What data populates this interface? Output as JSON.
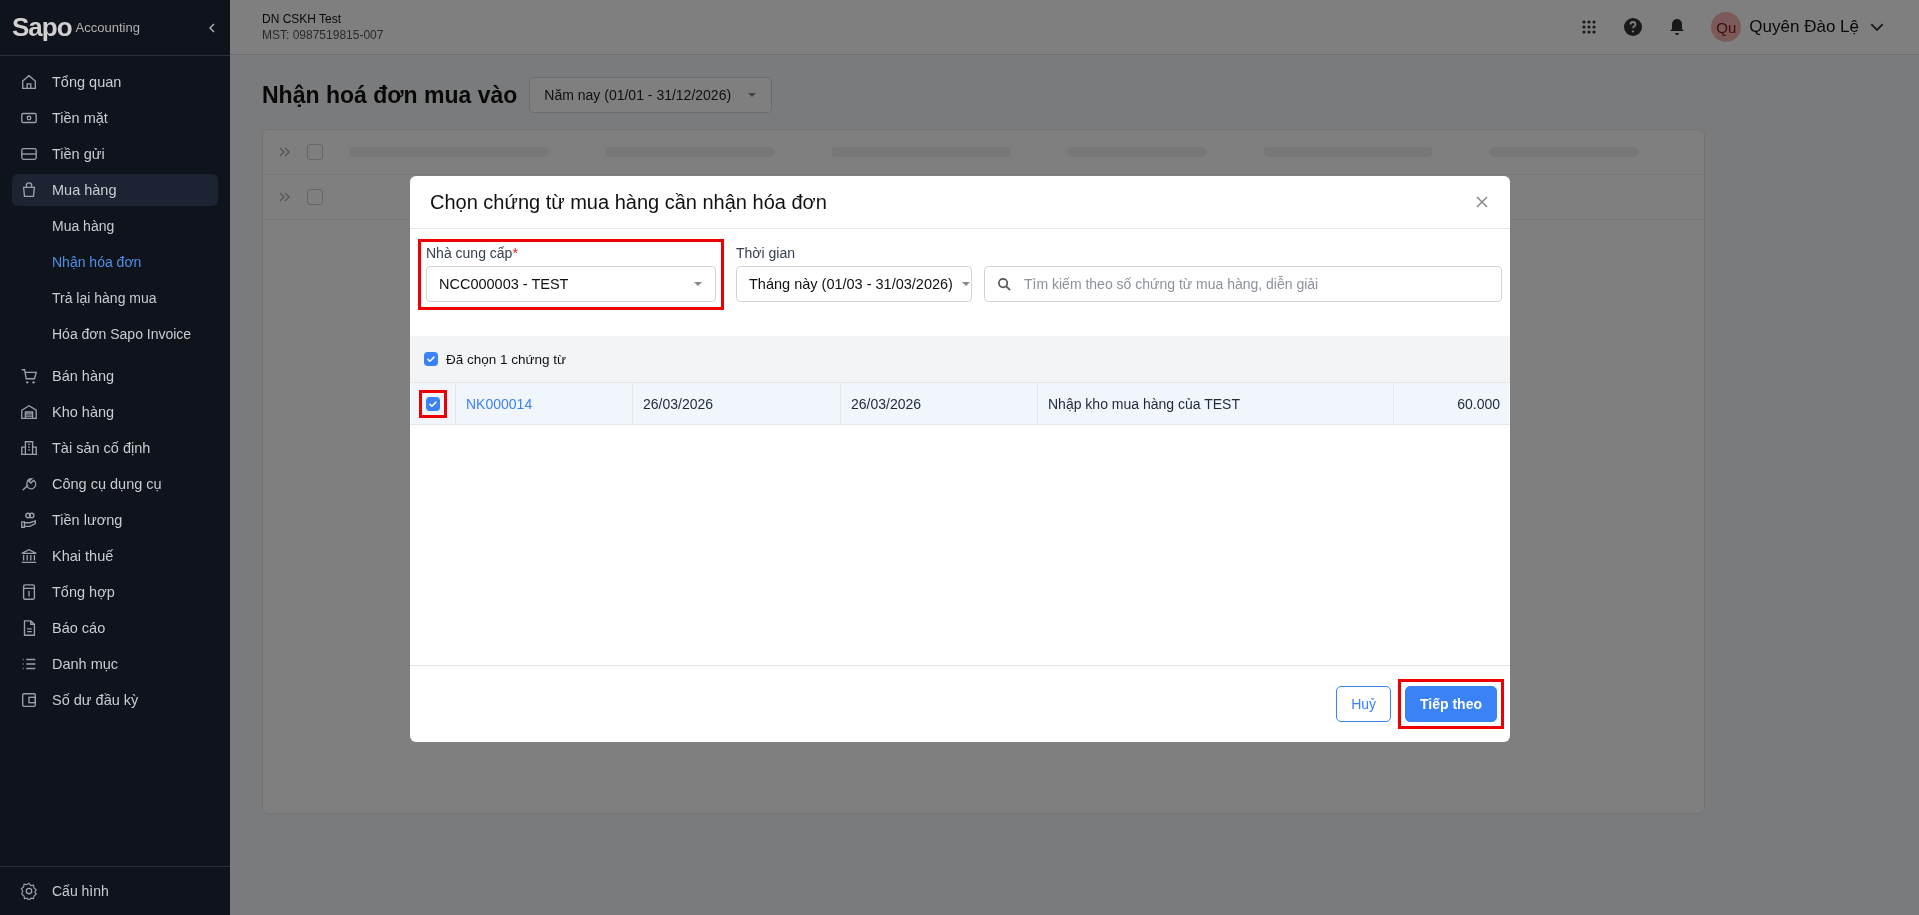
{
  "sidebar": {
    "logo": {
      "brand": "Sapo",
      "product": "Accounting"
    },
    "items": [
      {
        "label": "Tổng quan",
        "selected": false
      },
      {
        "label": "Tiền mặt",
        "selected": false
      },
      {
        "label": "Tiền gửi",
        "selected": false
      },
      {
        "label": "Mua hàng",
        "selected": true,
        "children": [
          {
            "label": "Mua hàng",
            "selected": false
          },
          {
            "label": "Nhận hóa đơn",
            "selected": true
          },
          {
            "label": "Trả lại hàng mua",
            "selected": false
          },
          {
            "label": "Hóa đơn Sapo Invoice",
            "selected": false
          }
        ]
      },
      {
        "label": "Bán hàng",
        "selected": false
      },
      {
        "label": "Kho hàng",
        "selected": false
      },
      {
        "label": "Tài sản cố định",
        "selected": false
      },
      {
        "label": "Công cụ dụng cụ",
        "selected": false
      },
      {
        "label": "Tiền lương",
        "selected": false
      },
      {
        "label": "Khai thuế",
        "selected": false
      },
      {
        "label": "Tổng hợp",
        "selected": false
      },
      {
        "label": "Báo cáo",
        "selected": false
      },
      {
        "label": "Danh mục",
        "selected": false
      },
      {
        "label": "Số dư đầu kỳ",
        "selected": false
      }
    ],
    "footer_item": {
      "label": "Cấu hình"
    }
  },
  "header": {
    "company": {
      "name": "DN CSKH Test",
      "tax_id": "MST: 0987519815-007"
    },
    "user": {
      "initials": "Qu",
      "name": "Quyên Đào Lệ"
    }
  },
  "page": {
    "title": "Nhận hoá đơn mua vào",
    "period_filter": "Năm nay (01/01 - 31/12/2026)",
    "loading_rows": [
      {
        "checked": false
      },
      {
        "checked": false
      }
    ]
  },
  "modal": {
    "title": "Chọn chứng từ mua hàng cần nhận hóa đơn",
    "supplier": {
      "label": "Nhà cung cấp",
      "required_mark": "*",
      "value": "NCC000003 - TEST",
      "highlighted": true
    },
    "period": {
      "label": "Thời gian",
      "value": "Tháng này (01/03 - 31/03/2026)"
    },
    "search": {
      "placeholder": "Tìm kiếm theo số chứng từ mua hàng, diễn giải"
    },
    "selection_summary": {
      "checked": true,
      "text": "Đã chọn 1 chứng từ"
    },
    "rows": [
      {
        "checked": true,
        "selected": true,
        "highlighted": true,
        "code": "NK000014",
        "cells": [
          "26/03/2026",
          "26/03/2026",
          "Nhập kho mua hàng của TEST",
          "60.000"
        ]
      }
    ],
    "buttons": [
      {
        "label": "Huỷ",
        "kind": "secondary",
        "highlighted": false
      },
      {
        "label": "Tiếp theo",
        "kind": "primary",
        "highlighted": true
      }
    ]
  }
}
